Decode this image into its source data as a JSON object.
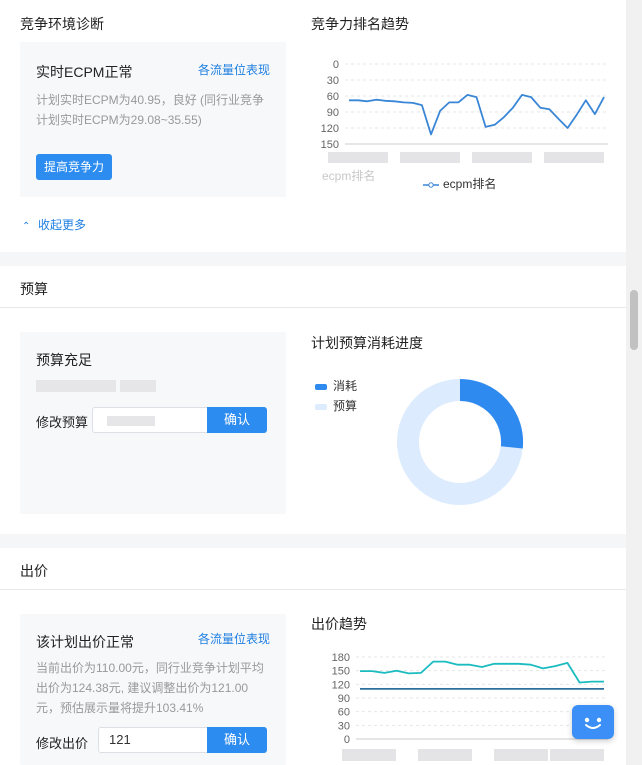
{
  "competition": {
    "title": "竞争环境诊断",
    "card_title": "实时ECPM正常",
    "card_link": "各流量位表现",
    "desc_line1": "计划实时ECPM为40.95，良好 (同行业竞争",
    "desc_line2": "计划实时ECPM为29.08~35.55)",
    "button": "提高竞争力",
    "collapse": "收起更多",
    "chart_title": "竞争力排名趋势"
  },
  "budget": {
    "section_title": "预算",
    "card_title": "预算充足",
    "edit_label": "修改预算",
    "confirm": "确认",
    "chart_title": "计划预算消耗进度"
  },
  "bid": {
    "section_title": "出价",
    "card_title": "该计划出价正常",
    "card_link": "各流量位表现",
    "desc_line1": "当前出价为110.00元，同行业竞争计划平均",
    "desc_line2": "出价为124.38元, 建议调整出价为121.00",
    "desc_line3": "元，预估展示量将提升103.41%",
    "edit_label": "修改出价",
    "input_value": "121",
    "confirm": "确认",
    "chart_title": "出价趋势"
  },
  "colors": {
    "accent": "#2d8cf0",
    "line_blue": "#3a86d6",
    "line_teal": "#1bbcc0",
    "line_dark": "#2e6f9e",
    "donut_light": "#dcebfd",
    "donut_dark": "#2f8af0"
  },
  "chart_data": [
    {
      "type": "line",
      "title": "竞争力排名趋势",
      "series": [
        {
          "name": "ecpm排名",
          "values": [
            68,
            68,
            70,
            67,
            69,
            70,
            72,
            73,
            77,
            132,
            88,
            72,
            72,
            58,
            62,
            118,
            114,
            100,
            82,
            58,
            62,
            82,
            85,
            103,
            120,
            95,
            68,
            94,
            62
          ]
        }
      ],
      "ylabel": "ecpm排名",
      "ylim": [
        0,
        150
      ],
      "yticks": [
        0,
        30,
        60,
        90,
        120,
        150
      ],
      "y_inverted": true,
      "grid": true,
      "legend": "bottom"
    },
    {
      "type": "pie",
      "title": "计划预算消耗进度",
      "labels": [
        "消耗",
        "预算"
      ],
      "legend": "top-left"
    },
    {
      "type": "line",
      "title": "出价趋势",
      "series": [
        {
          "values": [
            149,
            149,
            145,
            150,
            144,
            145,
            170,
            170,
            163,
            163,
            158,
            165,
            165,
            165,
            163,
            155,
            160,
            167,
            124,
            126,
            126
          ]
        },
        {
          "values": [
            110,
            110,
            110,
            110,
            110,
            110,
            110,
            110,
            110,
            110,
            110,
            110,
            110,
            110,
            110,
            110,
            110,
            110,
            110,
            110,
            110
          ]
        }
      ],
      "ylim": [
        0,
        180
      ],
      "yticks": [
        0,
        30,
        60,
        90,
        120,
        150,
        180
      ],
      "grid": true
    }
  ]
}
